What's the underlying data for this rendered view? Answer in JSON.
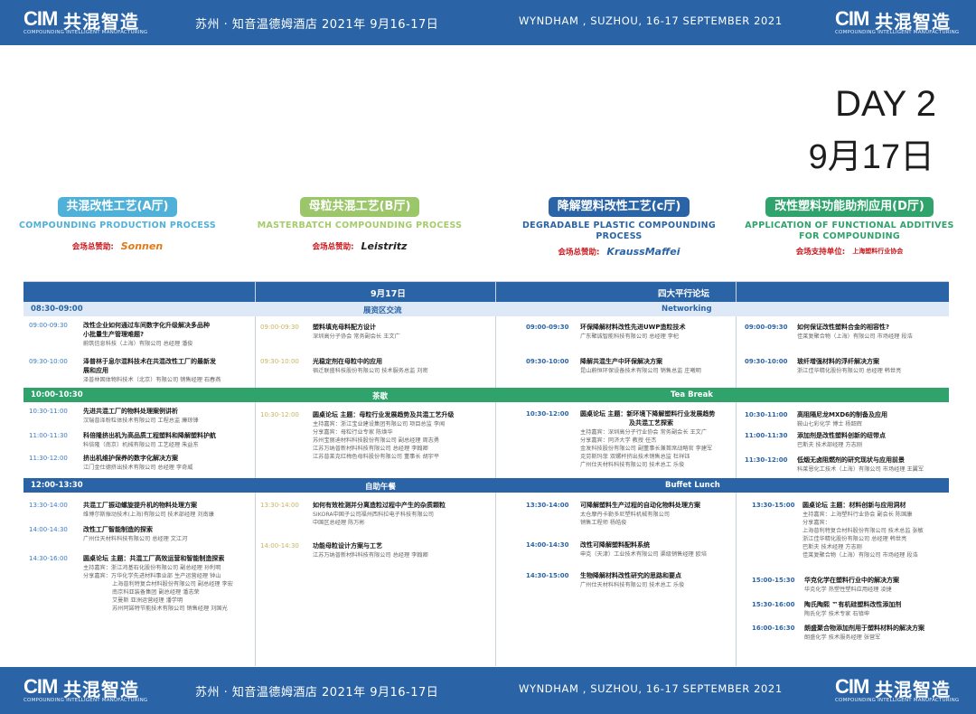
{
  "header": {
    "logo_cim": "CIM",
    "logo_cn": "共混智造",
    "logo_en": "COMPOUNDING INTELLIGENT MANUFACTURING",
    "venue_cn": "苏州 · 知音温德姆酒店    2021年 9月16-17日",
    "venue_en": "WYNDHAM , SUZHOU, 16-17 SEPTEMBER 2021"
  },
  "day": {
    "label": "DAY 2",
    "date": "9月17日"
  },
  "halls": [
    {
      "cn": "共混改性工艺(A厅)",
      "en": "COMPOUNDING PRODUCTION PROCESS",
      "sponsor_label": "会场总赞助:",
      "sponsor": "Sonnen",
      "color": "#4fb0d8",
      "en_color": "#4fb0d8"
    },
    {
      "cn": "母粒共混工艺(B厅)",
      "en": "MASTERBATCH COMPOUNDING PROCESS",
      "sponsor_label": "会场总赞助:",
      "sponsor": "Leistritz",
      "color": "#9cc66a",
      "en_color": "#a5cc6c"
    },
    {
      "cn": "降解塑料改性工艺(c厅)",
      "en": "DEGRADABLE PLASTIC COMPOUNDING PROCESS",
      "sponsor_label": "会场总赞助:",
      "sponsor": "KraussMaffei",
      "color": "#2a64a6",
      "en_color": "#2a64a6"
    },
    {
      "cn": "改性塑料功能助剂应用(D厅)",
      "en": "APPLICATION OF FUNCTIONAL ADDITIVES FOR COMPOUNDING",
      "sponsor_label": "会场支持单位:",
      "sponsor": "上海塑料行业协会",
      "color": "#2fa36b",
      "en_color": "#2fa36b"
    }
  ],
  "table": {
    "head_left": "9月17日",
    "head_right": "四大平行论坛",
    "bands": [
      {
        "time": "08:30-09:00",
        "left": "展资区交流",
        "right": "Networking",
        "style": "light"
      },
      {
        "time": "10:00-10:30",
        "left": "茶歇",
        "right": "Tea Break",
        "style": "green"
      },
      {
        "time": "12:00-13:30",
        "left": "自助午餐",
        "right": "Buffet Lunch",
        "style": "blue"
      }
    ],
    "col1": [
      {
        "time": "09:00-09:30",
        "title": "改性企业如何通过车间数字化升级解决多品种",
        "title2": "小批量生产管理难题?",
        "sub": "蔚筑信息科技（上海）有限公司  总经理  潘俊"
      },
      {
        "time": "09:30-10:00",
        "title": "泽普林于息尔混料技术在共混改性工厂的最新发",
        "title2": "展和应用",
        "sub": "泽普林固体物料技术（北京）有限公司  销售经理  石春燕"
      },
      {
        "time": "10:30-11:00",
        "title": "先进共混工厂的物料处理案例讲析",
        "title2": "",
        "sub": "汉瑞普泽粉粒体技术有限公司  工程总监  廉琼锋"
      },
      {
        "time": "11:00-11:30",
        "title": "科倍隆挤出机为高品质工程塑料和降解塑料护航",
        "title2": "",
        "sub": "科倍隆（南京）机械有限公司  工艺经理  朱益东"
      },
      {
        "time": "11:30-12:00",
        "title": "挤出机维护保养的数字化解决方案",
        "title2": "",
        "sub": "江门金仕德挤出技术有限公司  总经理  李奇威"
      },
      {
        "time": "13:30-14:00",
        "title": "共混工厂振动螺旋提升机的物料处理方案",
        "title2": "",
        "sub": "维博尔斯振动技术(上海)有限公司  技术部经理  刘南康"
      },
      {
        "time": "14:00-14:30",
        "title": "改性工厂智能制造的探索",
        "title2": "",
        "sub": "广州仕天材料科技有限公司  总经理  文江河"
      },
      {
        "time": "14:30-16:00",
        "title": "圆桌论坛  主题：共混工厂高效运营和智能制造探索",
        "title2": "",
        "sub": "主持嘉宾：浙江鸿基石化股份有限公司  副总经理  孙利明"
      }
    ],
    "col1_panel": [
      "分享嘉宾：万华化学先进材料事业部  生产运营经理  钟山",
      "上海普利特复合材料股份有限公司  副总经理  李宏",
      "南京科亚装备集团  副总经理  潘志荣",
      "艾曼斯  亚洲运营经理  潘学明",
      "苏州阿諾特节能技术有限公司  销售经理  刘国光"
    ],
    "col2": [
      {
        "time": "09:00-09:30",
        "title": "塑料填充母料配方设计",
        "sub": "深圳高分子协会  常务副会长  王文广"
      },
      {
        "time": "09:30-10:00",
        "title": "光稳定剂在母粒中的应用",
        "sub": "宿迁联盛科技股份有限公司  技术服务总监  刘密"
      },
      {
        "time": "10:30-12:00",
        "title": "圆桌论坛  主题：母粒行业发展趋势及共混工艺升级",
        "sub": "主持嘉宾：浙江宝业建设集团有限公司  项目总监  李闻"
      },
      {
        "time": "13:30-14:00",
        "title": "如何有效检测并分离造粒过程中产生的杂质颗粒",
        "sub": "SIKORA中国子公司福州西科拉电子科技有限公司"
      },
      {
        "time": "14:00-14:30",
        "title": "功能母粒设计方案与工艺",
        "sub": "江苏万纳普新材料科技有限公司  总经理  李翰卿"
      }
    ],
    "col2_panel": [
      "分享嘉宾：母粒行业专家  陈焕华",
      "苏州宝丽迪材料科技股份有限公司  副总经理  周志勇",
      "江苏万纳普新材料科技有限公司  总经理  李翰卿",
      "江苏普莱克红梅色母料股份有限公司  董事长  胡宇平"
    ],
    "col2_extra": [
      "中国区总经理  陈万彬"
    ],
    "col3": [
      {
        "time": "09:00-09:30",
        "title": "环保降解材料改性先进UWP造粒技术",
        "sub": "广东聚诚智能科技有限公司  总经理  李杞"
      },
      {
        "time": "09:30-10:00",
        "title": "降解共混生产中环保解决方案",
        "sub": "昆山蔚恒环保设备技术有限公司  销售总监  庄曦明"
      },
      {
        "time": "10:30-12:00",
        "title": "圆桌论坛  主题：新环境下降解塑料行业发展趋势",
        "sub": ""
      },
      {
        "time": "13:30-14:00",
        "title": "可降解塑料生产过程的自动化物料处理方案",
        "sub": "太仓摩丹卡勒多尼塑料机械有限公司"
      },
      {
        "time": "14:00-14:30",
        "title": "改性可降解塑料配料系统",
        "sub": "申克（天津）工业技术有限公司  渠级销售经理  欧培"
      },
      {
        "time": "14:30-15:00",
        "title": "生物降解材料改性研究的思路和要点",
        "sub": "广州仕天材料科技有限公司  技术总工  乐俊"
      }
    ],
    "col3_panel": [
      "及共混工艺探索",
      "主持嘉宾：深圳高分子行业协会  常务副会长  王文广",
      "分享嘉宾：同济大学  教授  任杰",
      "金发科技股份有限公司  副董事长兼首席战略官  李建军",
      "克劳斯玛菲  双螺杆挤出技术销售总监  杜祥钰",
      "广州仕天材料科技有限公司  技术总工  乐俊"
    ],
    "col3_extra": [
      "销售工程师  杨皓俊"
    ],
    "col4": [
      {
        "time": "09:00-09:30",
        "title": "如何保证改性塑料合金的相容性?",
        "sub": "佳莱复聚合物（上海）有限公司  市场经理  段浩"
      },
      {
        "time": "09:30-10:00",
        "title": "玻纤增强材料的浮纤解决方案",
        "sub": "浙江佳华精化股份有限公司  总经理  韩世亮"
      },
      {
        "time": "10:30-11:00",
        "title": "高阻隔尼龙MXD6的制备及应用",
        "sub": "鞍山七彩化学  博士  杨韶辉"
      },
      {
        "time": "11:00-11:30",
        "title": "添加剂是改性塑料创新的纽带点",
        "sub": "巴斯夫  技术部经理  方志刚"
      },
      {
        "time": "11:30-12:00",
        "title": "低烟无卤阻燃剂的研究现状与应用前景",
        "sub": "科莱恩化工技术（上海）有限公司  市场经理  王翼军"
      },
      {
        "time": "13:30-15:00",
        "title": "圆桌论坛  主题：材料创新与应用洞材",
        "sub": "主持嘉宾：上海塑料行业协会  副会长  陈国康"
      },
      {
        "time": "15:00-15:30",
        "title": "华克化学在塑料行业中的解决方案",
        "sub": "华克化学  热塑性塑料应用经理  凌捷"
      },
      {
        "time": "15:30-16:00",
        "title": "陶氏陶熙 ™有机硅塑料改性添加剂",
        "sub": "陶氏化学  技术专家  石镇坤"
      },
      {
        "time": "16:00-16:30",
        "title": "朗盛聚合物添加剂用于塑料材料的解决方案",
        "sub": "朗盛化学  技术服务经理  张营军"
      }
    ],
    "col4_panel": [
      "分享嘉宾：",
      "上海普利特复合材料股份有限公司  技术总监  张敏",
      "浙江佳华精化股份有限公司  总经理  韩世亮",
      "巴斯夫  技术经理  方志刚",
      "佳莱复聚合物（上海）有限公司  市场经理  段浩"
    ]
  },
  "colors": {
    "band": "#2a64a6",
    "green": "#2fa36b",
    "light": "#dde9f6"
  }
}
